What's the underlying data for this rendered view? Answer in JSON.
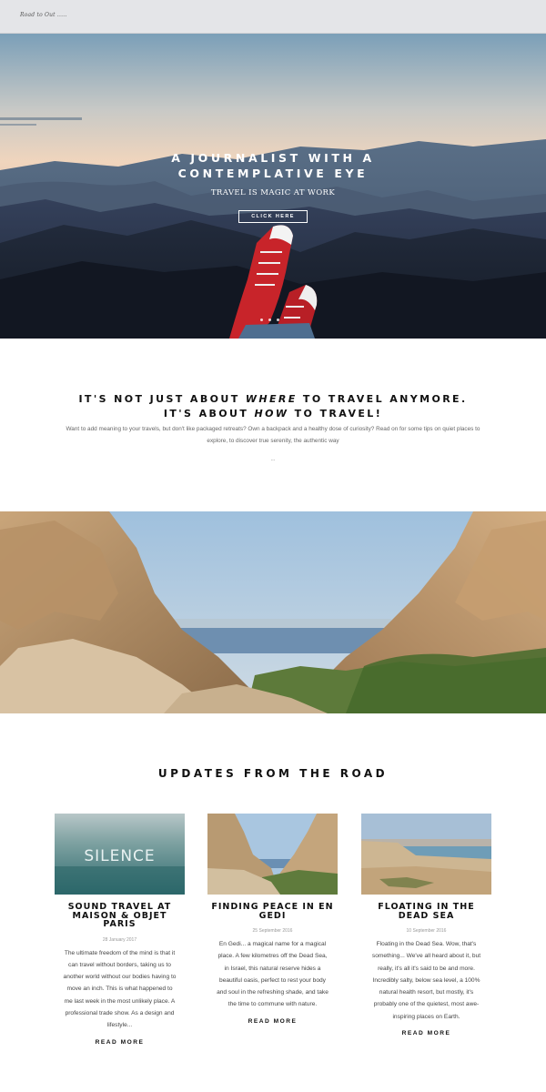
{
  "header": {
    "logo": "Road to Out ....."
  },
  "hero": {
    "title_line1": "A JOURNALIST WITH A",
    "title_line2": "CONTEMPLATIVE EYE",
    "subtitle": "TRAVEL IS MAGIC AT WORK",
    "button": "CLICK HERE"
  },
  "intro": {
    "line1_a": "IT'S NOT JUST ABOUT ",
    "line1_em": "WHERE",
    "line1_b": " TO TRAVEL ANYMORE.",
    "line2_a": "IT'S ABOUT ",
    "line2_em": "HOW",
    "line2_b": " TO TRAVEL!",
    "paragraph": "Want to add meaning to your travels, but don't like packaged retreats? Own a backpack and a healthy dose of curiosity? Read on for some tips on quiet places to explore, to discover true serenity, the authentic way",
    "ellipsis": "..."
  },
  "updates": {
    "heading": "UPDATES FROM THE ROAD",
    "posts": [
      {
        "title": "SOUND TRAVEL AT MAISON & OBJET PARIS",
        "image_text": "SILENCE",
        "date": "28 January 2017",
        "excerpt": "The ultimate freedom of the mind is that it can travel without borders, taking us to another world without our bodies having to move an inch. This is what happened to me last week in the most unlikely place. A professional trade show. As a design and lifestyle...",
        "more": "READ MORE"
      },
      {
        "title": "FINDING PEACE IN EN GEDI",
        "date": "25 September 2016",
        "excerpt": "En Gedi... a magical name for a magical place. A few kilometres off the Dead Sea, in Israel, this natural reserve hides a beautiful oasis, perfect to rest your body and soul in the refreshing shade, and take the time to commune with nature.",
        "more": "READ MORE"
      },
      {
        "title": "FLOATING IN THE DEAD SEA",
        "date": "10 September 2016",
        "excerpt": "Floating in the Dead Sea. Wow, that's something... We've all heard about it, but really, it's all it's said to be and more. Incredibly salty, below sea level, a 100% natural health resort, but mostly, it's probably one of the quietest, most awe-inspiring places on Earth.",
        "more": "READ MORE"
      }
    ]
  },
  "colors": {
    "text": "#111111",
    "muted": "#666666",
    "topbar": "#e4e5e8"
  }
}
